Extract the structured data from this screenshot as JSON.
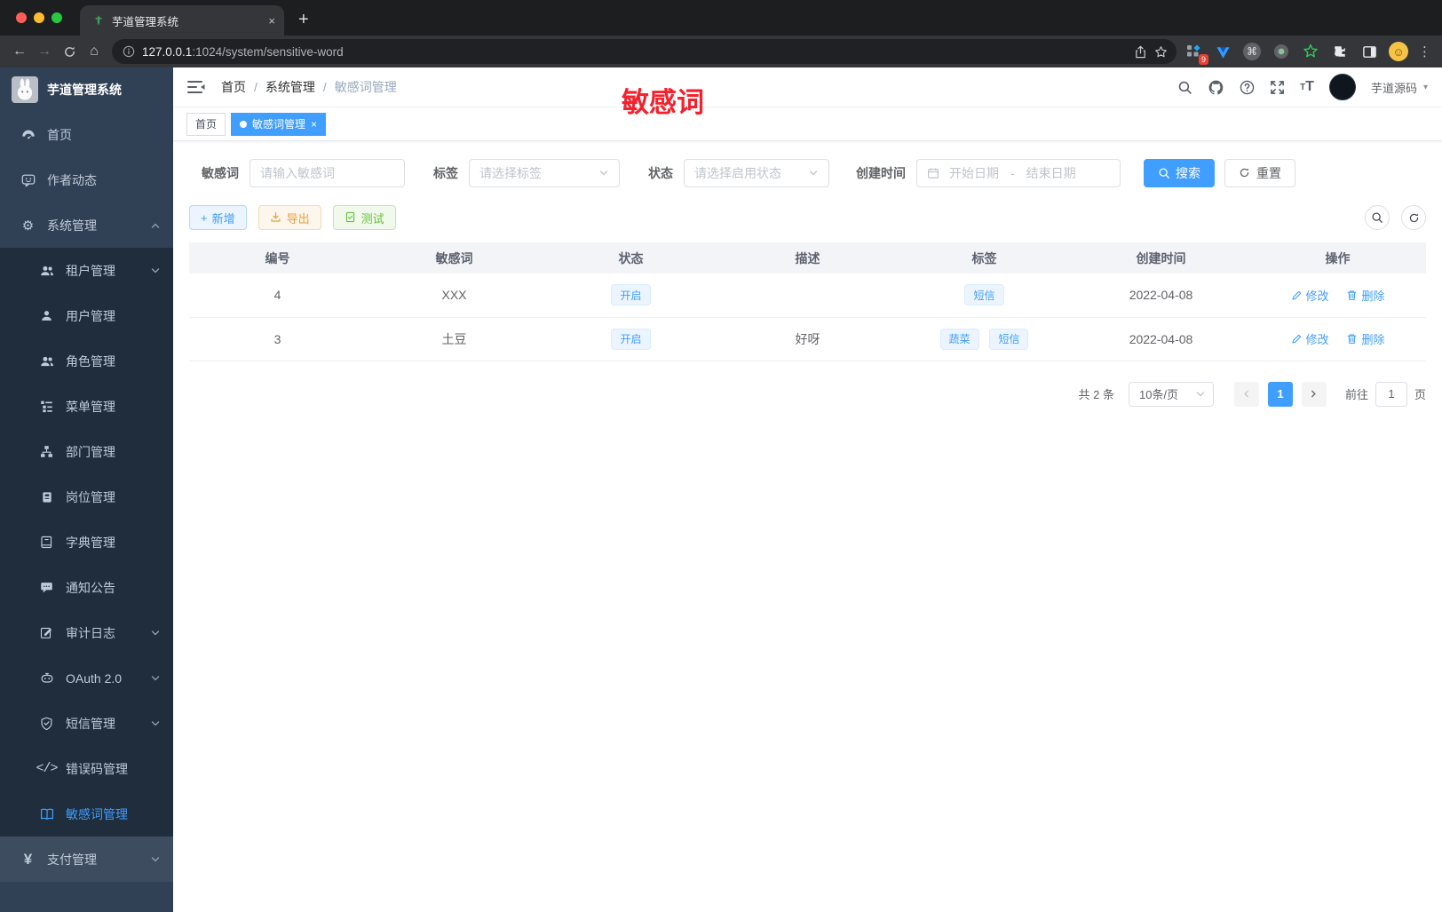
{
  "browser": {
    "tab_title": "芋道管理系统",
    "new_tab_button": "+",
    "url_host": "127.0.0.1",
    "url_path": ":1024/system/sensitive-word",
    "extension_badge": "9",
    "icons": {
      "back": "←",
      "forward": "→",
      "home": "⌂",
      "cmd": "⌘",
      "dots": "⋮",
      "smile": "☺"
    }
  },
  "sidebar": {
    "logo_title": "芋道管理系统",
    "items": [
      {
        "label": "首页"
      },
      {
        "label": "作者动态"
      },
      {
        "label": "系统管理"
      },
      {
        "label": "租户管理"
      },
      {
        "label": "用户管理"
      },
      {
        "label": "角色管理"
      },
      {
        "label": "菜单管理"
      },
      {
        "label": "部门管理"
      },
      {
        "label": "岗位管理"
      },
      {
        "label": "字典管理"
      },
      {
        "label": "通知公告"
      },
      {
        "label": "审计日志"
      },
      {
        "label": "OAuth 2.0"
      },
      {
        "label": "短信管理"
      },
      {
        "label": "错误码管理"
      },
      {
        "label": "敏感词管理"
      },
      {
        "label": "支付管理"
      }
    ],
    "icon_glyphs": {
      "gear": "⚙",
      "pen": "✎",
      "yen": "¥",
      "code": "</>"
    }
  },
  "header": {
    "breadcrumb": [
      "首页",
      "系统管理",
      "敏感词管理"
    ],
    "separator": "/",
    "username": "芋道源码",
    "caret": "▾",
    "font_icon_small": "T",
    "font_icon_big": "T"
  },
  "annotation": {
    "text": "敏感词",
    "color": "#f5222d"
  },
  "tags_view": {
    "tabs": [
      {
        "label": "首页",
        "active": false
      },
      {
        "label": "敏感词管理",
        "active": true
      }
    ],
    "close": "×"
  },
  "filters": {
    "keyword_label": "敏感词",
    "keyword_placeholder": "请输入敏感词",
    "tag_label": "标签",
    "tag_placeholder": "请选择标签",
    "status_label": "状态",
    "status_placeholder": "请选择启用状态",
    "date_label": "创建时间",
    "date_start_placeholder": "开始日期",
    "date_separator": "-",
    "date_end_placeholder": "结束日期",
    "search_label": "搜索",
    "reset_label": "重置"
  },
  "toolbar": {
    "add_label": "新增",
    "add_plus": "+",
    "export_label": "导出",
    "test_label": "测试"
  },
  "table": {
    "columns": [
      "编号",
      "敏感词",
      "状态",
      "描述",
      "标签",
      "创建时间",
      "操作"
    ],
    "rows": [
      {
        "id": "4",
        "word": "XXX",
        "status": "开启",
        "description": "",
        "tags": [
          "短信"
        ],
        "created": "2022-04-08",
        "edit": "修改",
        "delete": "删除"
      },
      {
        "id": "3",
        "word": "土豆",
        "status": "开启",
        "description": "好呀",
        "tags": [
          "蔬菜",
          "短信"
        ],
        "created": "2022-04-08",
        "edit": "修改",
        "delete": "删除"
      }
    ]
  },
  "pagination": {
    "total_text": "共 2 条",
    "page_size": "10条/页",
    "current_page": "1",
    "goto_label": "前往",
    "goto_value": "1",
    "page_suffix": "页"
  },
  "colors": {
    "primary": "#409eff",
    "sidebar_bg": "#304156",
    "submenu_bg": "#1f2d3d",
    "annotation_red": "#f5222d"
  }
}
